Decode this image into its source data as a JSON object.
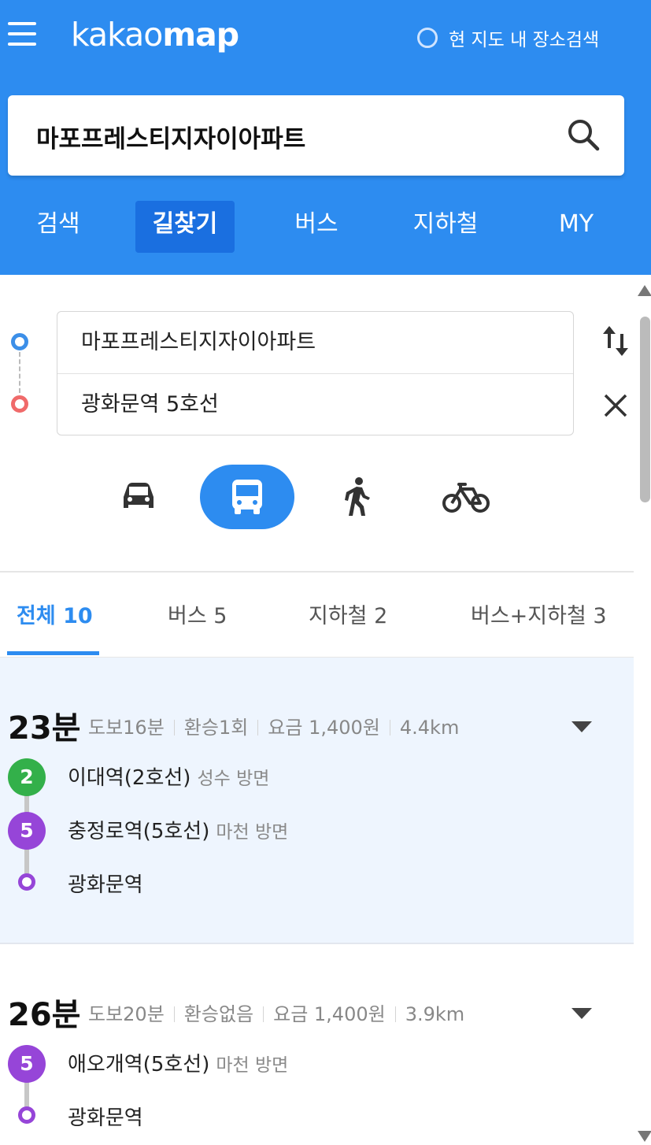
{
  "header": {
    "logo_light": "kakao",
    "logo_bold": "map",
    "scope_label": "현 지도 내 장소검색",
    "search_query": "마포프레스티지자이아파트",
    "tabs": [
      {
        "label": "검색",
        "active": false
      },
      {
        "label": "길찾기",
        "active": true
      },
      {
        "label": "버스",
        "active": false
      },
      {
        "label": "지하철",
        "active": false
      },
      {
        "label": "MY",
        "active": false
      }
    ]
  },
  "route": {
    "origin": "마포프레스티지자이아파트",
    "destination": "광화문역 5호선"
  },
  "modes": [
    {
      "icon": "car-icon",
      "active": false
    },
    {
      "icon": "bus-icon",
      "active": true
    },
    {
      "icon": "walk-icon",
      "active": false
    },
    {
      "icon": "bike-icon",
      "active": false
    }
  ],
  "filter_tabs": [
    {
      "label": "전체 10",
      "active": true
    },
    {
      "label": "버스 5",
      "active": false
    },
    {
      "label": "지하철 2",
      "active": false
    },
    {
      "label": "버스+지하철 3",
      "active": false
    }
  ],
  "results": [
    {
      "time": "23분",
      "walk": "도보16분",
      "transfer": "환승1회",
      "fare": "요금 1,400원",
      "distance": "4.4km",
      "steps": [
        {
          "badge": "2",
          "color": "#33b04a",
          "name": "이대역(2호선)",
          "direction": "성수 방면"
        },
        {
          "badge": "5",
          "color": "#9645d8",
          "name": "충정로역(5호선)",
          "direction": "마천 방면"
        },
        {
          "badge": "",
          "color": "#9645d8",
          "name": "광화문역",
          "direction": ""
        }
      ]
    },
    {
      "time": "26분",
      "walk": "도보20분",
      "transfer": "환승없음",
      "fare": "요금 1,400원",
      "distance": "3.9km",
      "steps": [
        {
          "badge": "5",
          "color": "#9645d8",
          "name": "애오개역(5호선)",
          "direction": "마천 방면"
        },
        {
          "badge": "",
          "color": "#9645d8",
          "name": "광화문역",
          "direction": ""
        }
      ]
    }
  ],
  "colors": {
    "brand": "#2d8cf0",
    "brand_dark": "#1a6fe0",
    "line2": "#33b04a",
    "line5": "#9645d8"
  }
}
